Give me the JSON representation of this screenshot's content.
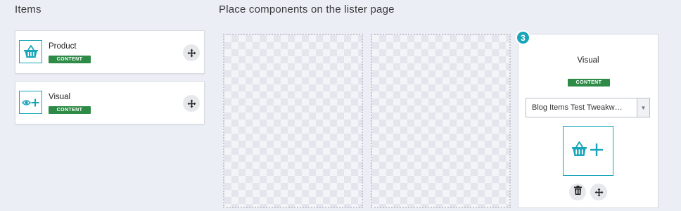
{
  "items_panel": {
    "heading": "Items",
    "items": [
      {
        "label": "Product",
        "badge": "CONTENT",
        "icon": "basket-icon"
      },
      {
        "label": "Visual",
        "badge": "CONTENT",
        "icon": "eye-plus-icon"
      }
    ]
  },
  "lister": {
    "heading": "Place components on the lister page",
    "placed_component": {
      "position_number": "3",
      "title": "Visual",
      "badge": "CONTENT",
      "select_value": "Blog Items Test Tweakw…",
      "add_icon": "basket-plus-icon",
      "delete_icon": "trash-icon",
      "move_icon": "move-icon"
    }
  },
  "colors": {
    "accent": "#19a5b9",
    "badge": "#2e8b47",
    "background": "#eceef6"
  }
}
